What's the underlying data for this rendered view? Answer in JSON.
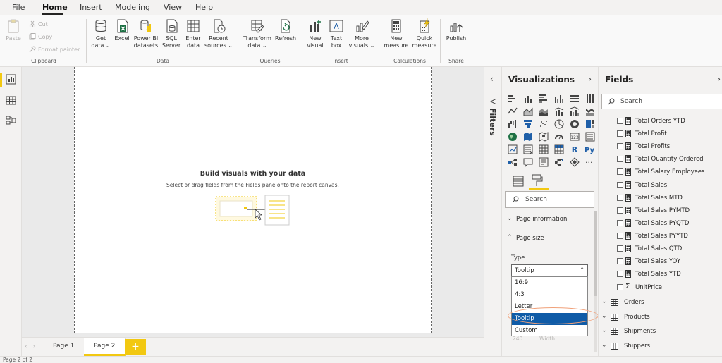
{
  "tabs": [
    {
      "label": "File"
    },
    {
      "label": "Home"
    },
    {
      "label": "Insert"
    },
    {
      "label": "Modeling"
    },
    {
      "label": "View"
    },
    {
      "label": "Help"
    }
  ],
  "ribbon": {
    "clipboard": {
      "label": "Clipboard",
      "paste": "Paste",
      "cut": "Cut",
      "copy": "Copy",
      "format_painter": "Format painter"
    },
    "data": {
      "label": "Data",
      "get_data_1": "Get",
      "get_data_2": "data",
      "excel": "Excel",
      "powerbi_1": "Power BI",
      "powerbi_2": "datasets",
      "sql_1": "SQL",
      "sql_2": "Server",
      "enter_1": "Enter",
      "enter_2": "data",
      "recent_1": "Recent",
      "recent_2": "sources"
    },
    "queries": {
      "label": "Queries",
      "transform_1": "Transform",
      "transform_2": "data",
      "refresh": "Refresh"
    },
    "insert": {
      "label": "Insert",
      "new_visual_1": "New",
      "new_visual_2": "visual",
      "textbox_1": "Text",
      "textbox_2": "box",
      "more_1": "More",
      "more_2": "visuals"
    },
    "calculations": {
      "label": "Calculations",
      "new_measure_1": "New",
      "new_measure_2": "measure",
      "quick_1": "Quick",
      "quick_2": "measure"
    },
    "share": {
      "label": "Share",
      "publish": "Publish"
    }
  },
  "canvas": {
    "empty_title": "Build visuals with your data",
    "empty_subtitle": "Select or drag fields from the Fields pane onto the report canvas."
  },
  "pages": {
    "tabs": [
      {
        "label": "Page 1"
      },
      {
        "label": "Page 2"
      }
    ],
    "add": "+"
  },
  "status": "Page 2 of 2",
  "filters": {
    "label": "Filters"
  },
  "visualizations": {
    "title": "Visualizations",
    "search_placeholder": "Search",
    "sections": {
      "page_information": "Page information",
      "page_size": "Page size"
    },
    "type_label": "Type",
    "type_selected": "Tooltip",
    "type_options": [
      {
        "label": "16:9"
      },
      {
        "label": "4:3"
      },
      {
        "label": "Letter"
      },
      {
        "label": "Tooltip"
      },
      {
        "label": "Custom"
      }
    ],
    "faded_value": "240",
    "faded_label": "Width",
    "more_glyph": "..."
  },
  "fields": {
    "title": "Fields",
    "search_placeholder": "Search",
    "measures": [
      {
        "label": "Total Orders YTD"
      },
      {
        "label": "Total Profit"
      },
      {
        "label": "Total Profits"
      },
      {
        "label": "Total Quantity Ordered"
      },
      {
        "label": "Total Salary Employees"
      },
      {
        "label": "Total Sales"
      },
      {
        "label": "Total Sales MTD"
      },
      {
        "label": "Total Sales PYMTD"
      },
      {
        "label": "Total Sales PYQTD"
      },
      {
        "label": "Total Sales PYYTD"
      },
      {
        "label": "Total Sales QTD"
      },
      {
        "label": "Total Sales YOY"
      },
      {
        "label": "Total Sales YTD"
      }
    ],
    "sum_field": {
      "label": "UnitPrice",
      "glyph": "Σ"
    },
    "tables": [
      {
        "label": "Orders"
      },
      {
        "label": "Products"
      },
      {
        "label": "Shipments"
      },
      {
        "label": "Shippers"
      }
    ]
  },
  "colors": {
    "accent": "#f2c811",
    "selection": "#0f5ba7",
    "highlight_ellipse": "#f0a17a"
  }
}
